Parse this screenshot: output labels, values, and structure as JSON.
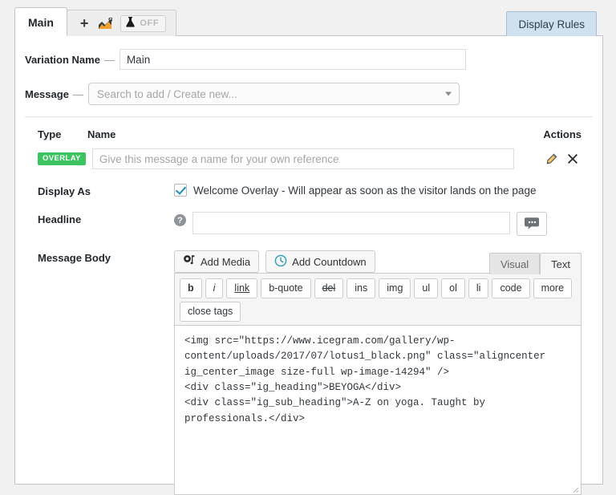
{
  "tabs": {
    "main_label": "Main",
    "add_label": "+",
    "stats_icon": "analytics-chart-icon",
    "ab_test_icon": "lab-flask-icon",
    "ab_test_state": "OFF"
  },
  "display_rules": {
    "label": "Display Rules"
  },
  "variation": {
    "label": "Variation Name",
    "dash": "—",
    "value": "Main"
  },
  "message_select": {
    "label": "Message",
    "dash": "—",
    "placeholder": "Search to add / Create new..."
  },
  "message_table": {
    "headers": {
      "type": "Type",
      "name": "Name",
      "actions": "Actions"
    },
    "row": {
      "badge": "OVERLAY",
      "name_placeholder": "Give this message a name for your own reference",
      "name_value": "",
      "edit_icon": "pencil-edit-icon",
      "delete_icon": "close-x-icon"
    }
  },
  "display_as": {
    "label": "Display As",
    "checked": true,
    "option_label": "Welcome Overlay - Will appear as soon as the visitor lands on the page"
  },
  "headline": {
    "label": "Headline",
    "help_icon": "question-help-icon",
    "value": "",
    "placeholder": "",
    "bubble_icon": "speech-bubble-icon"
  },
  "message_body": {
    "label": "Message Body",
    "add_media_label": "Add Media",
    "add_media_icon": "media-camera-icon",
    "add_countdown_label": "Add Countdown",
    "add_countdown_icon": "clock-icon",
    "editor_tabs": [
      {
        "label": "Visual",
        "active": false
      },
      {
        "label": "Text",
        "active": true
      }
    ],
    "quicktags": [
      "b",
      "i",
      "link",
      "b-quote",
      "del",
      "ins",
      "img",
      "ul",
      "ol",
      "li",
      "code",
      "more",
      "close tags"
    ],
    "content": "<img src=\"https://www.icegram.com/gallery/wp-content/uploads/2017/07/lotus1_black.png\" class=\"aligncenter ig_center_image size-full wp-image-14294\" />\n<div class=\"ig_heading\">BEYOGA</div>\n<div class=\"ig_sub_heading\">A-Z on yoga. Taught by professionals.</div>"
  },
  "colors": {
    "badge_green": "#3bc45f",
    "display_rules_bg": "#cfe0ef",
    "checkbox_blue": "#1e8cbe",
    "countdown_teal": "#2e9bb5"
  }
}
